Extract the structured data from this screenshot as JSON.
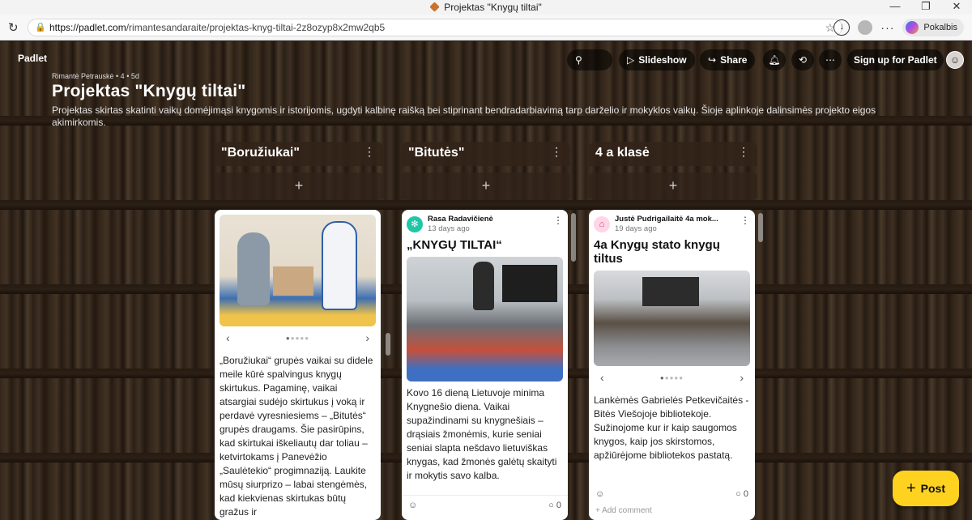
{
  "browser": {
    "window_title": "Projektas \"Knygų tiltai\"",
    "url_host": "https://padlet.com",
    "url_path": "/rimantesandaraite/projektas-knyg-tiltai-2z8ozyp8x2mw2qb5",
    "copilot_label": "Pokalbis",
    "win_minimize": "—",
    "win_restore": "❐",
    "win_close": "✕"
  },
  "nav": {
    "brand": "Padlet",
    "slideshow": "Slideshow",
    "share": "Share",
    "signup": "Sign up for Padlet"
  },
  "header": {
    "meta": "Rimantė Petrauskė • 4 • 5d",
    "title": "Projektas \"Knygų tiltai\"",
    "description": "Projektas skirtas skatinti vaikų domėjimąsi knygomis ir istorijomis, ugdyti kalbinę raišką bei stiprinant bendradarbiavimą tarp darželio ir mokyklos vaikų. Šioje aplinkoje dalinsimės projekto eigos akimirkomis."
  },
  "columns": [
    {
      "title": "\"Boružiukai\"",
      "add": "+",
      "card": {
        "text": "„Boružiukai“ grupės vaikai su didele meile kūrė spalvingus knygų skirtukus. Pagaminę, vaikai atsargiai sudėjo skirtukus į voką ir perdavė vyresniesiems – „Bitutės“ grupės draugams. Šie pasirūpins, kad skirtukai iškeliautų dar toliau – ketvirtokams į Panevėžio „Saulėtekio“ progimnaziją. Laukite mūsų siurprizo – labai stengėmės, kad kiekvienas skirtukas būtų gražus ir"
      }
    },
    {
      "title": "\"Bitutės\"",
      "add": "+",
      "card": {
        "author": "Rasa Radavičienė",
        "time": "13 days ago",
        "title": "„KNYGŲ TILTAI“",
        "text": "Kovo 16 dieną Lietuvoje minima Knygnešio diena. Vaikai supažindinami su knygnešiais – drąsiais žmonėmis, kurie seniai seniai slapta nešdavo lietuviškas knygas, kad žmonės galėtų skaityti ir mokytis savo kalba.",
        "comments": "0"
      }
    },
    {
      "title": "4 a klasė",
      "add": "+",
      "card": {
        "author": "Justė Pudrigailaitė 4a mok...",
        "time": "19 days ago",
        "title": "4a Knygų stato knygų tiltus",
        "text": "Lankėmės Gabrielės Petkevičaitės - Bitės Viešojoje bibliotekoje. Sužinojome kur ir kaip saugomos knygos, kaip jos skirstomos, apžiūrėjome bibliotekos pastatą.",
        "comments": "0",
        "add_comment": "Add comment"
      }
    }
  ],
  "fab": {
    "label": "Post"
  },
  "icons": {
    "search": "search-icon",
    "play": "play-icon",
    "share": "share-arrow-icon",
    "bell": "bell-icon",
    "remake": "remake-icon",
    "more": "more-horizontal-icon"
  }
}
